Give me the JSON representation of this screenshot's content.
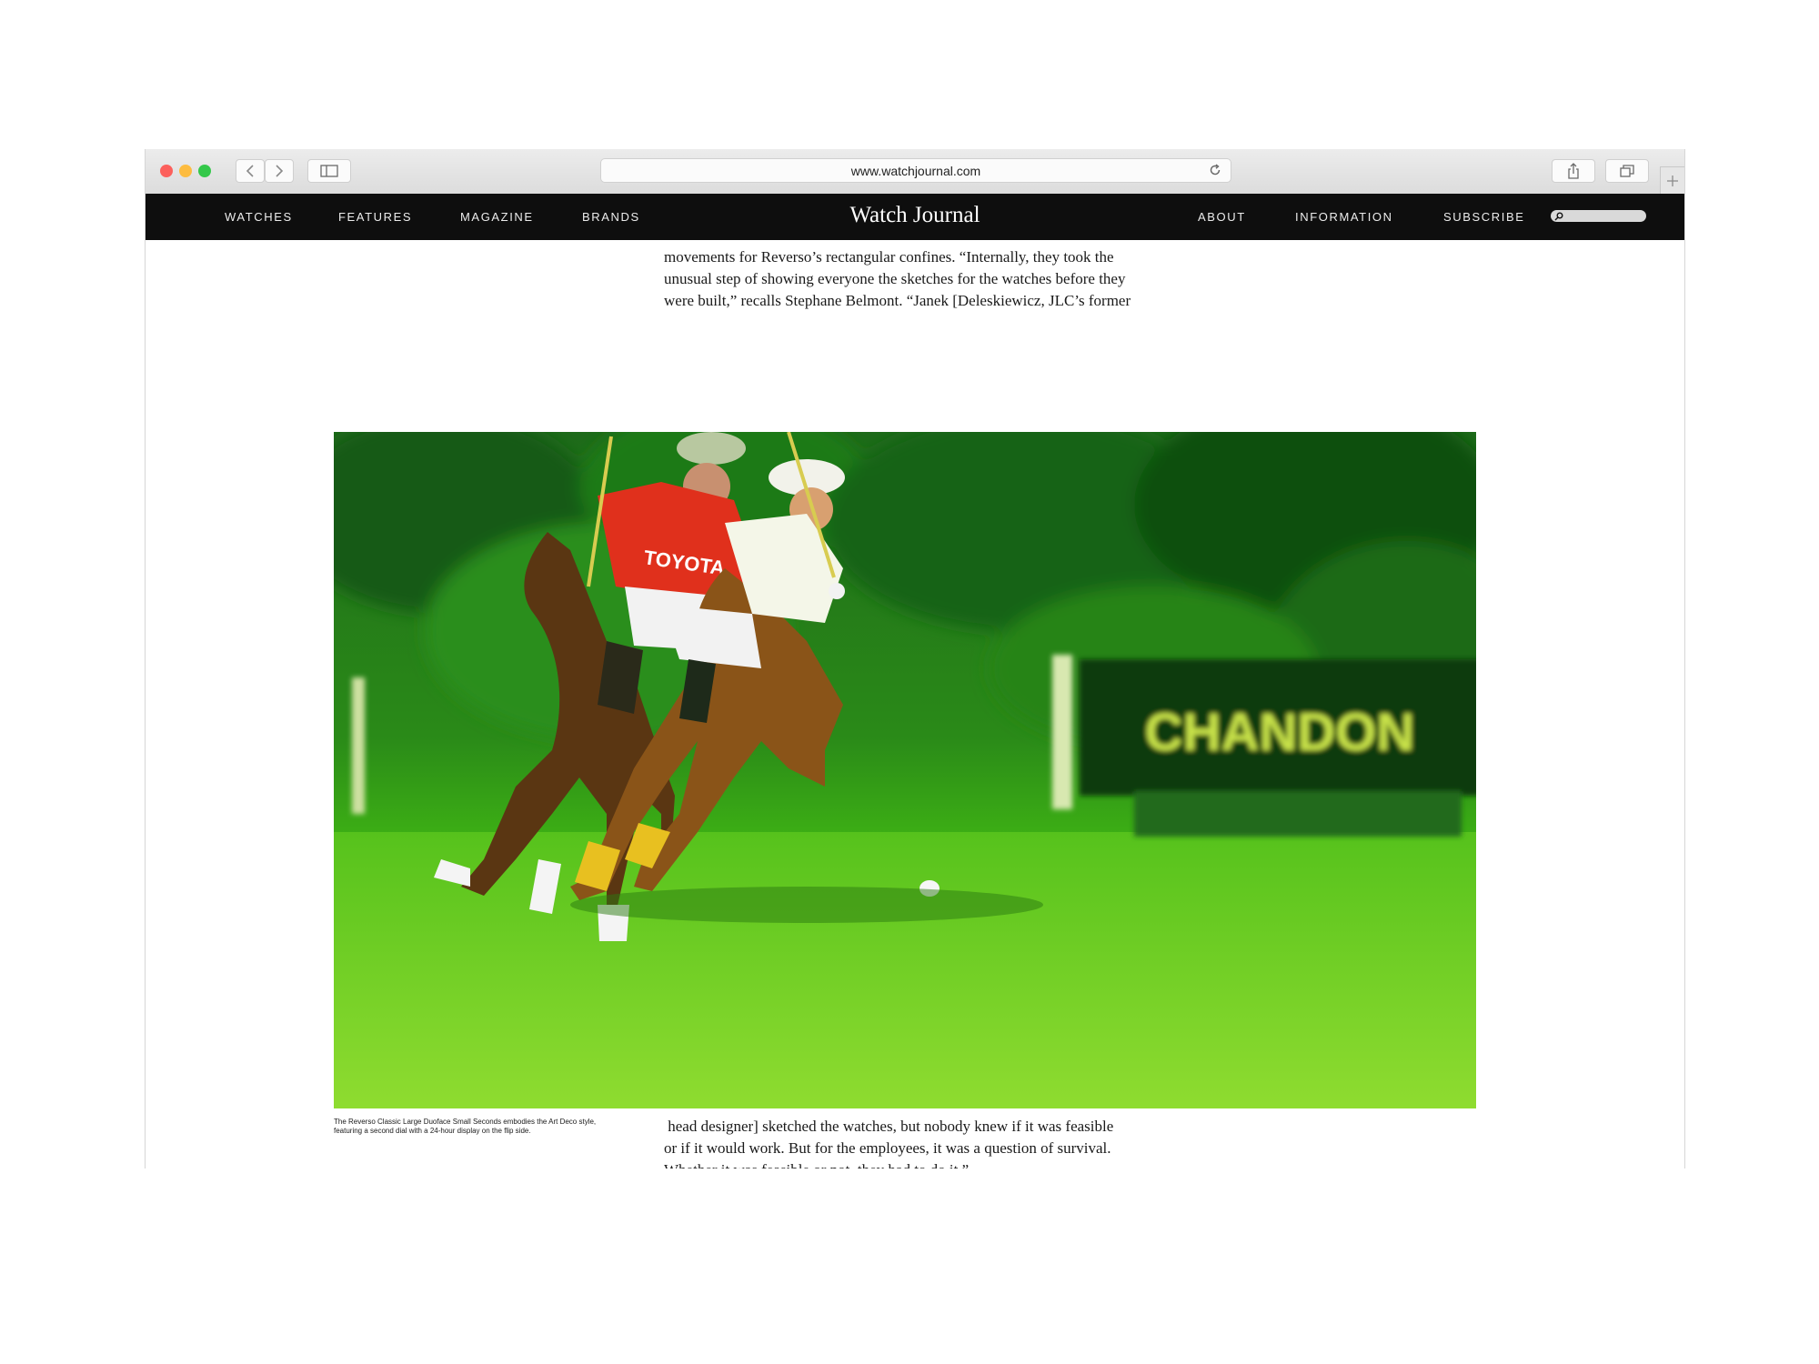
{
  "browser": {
    "url": "www.watchjournal.com"
  },
  "site": {
    "brand": "Watch Journal",
    "nav_left": [
      "WATCHES",
      "FEATURES",
      "MAGAZINE",
      "BRANDS"
    ],
    "nav_right": [
      "ABOUT",
      "INFORMATION",
      "SUBSCRIBE"
    ]
  },
  "article": {
    "top_lines": [
      "movements for Reverso’s rectangular confines. “Internally, they took the",
      "unusual step of showing everyone the sketches for the watches before they",
      "were built,” recalls Stephane Belmont. “Janek [Deleskiewicz, JLC’s former"
    ],
    "photo_sign": "CHANDON",
    "photo_jersey": "TOYOTA",
    "caption_lines": [
      "The Reverso Classic Large Duoface Small Seconds embodies the Art Deco style,",
      "featuring a second dial with a 24-hour display on the flip side."
    ],
    "bottom_lines": [
      " head designer] sketched the watches, but nobody knew if it was feasible",
      "or if it would work. But for the employees, it was a question of survival.",
      "Whether it was feasible or not, they had to do it.”"
    ]
  },
  "colors": {
    "nav_bg": "#0e0e0e",
    "photo_green": "#4fc016",
    "jersey_red": "#e0301c"
  }
}
